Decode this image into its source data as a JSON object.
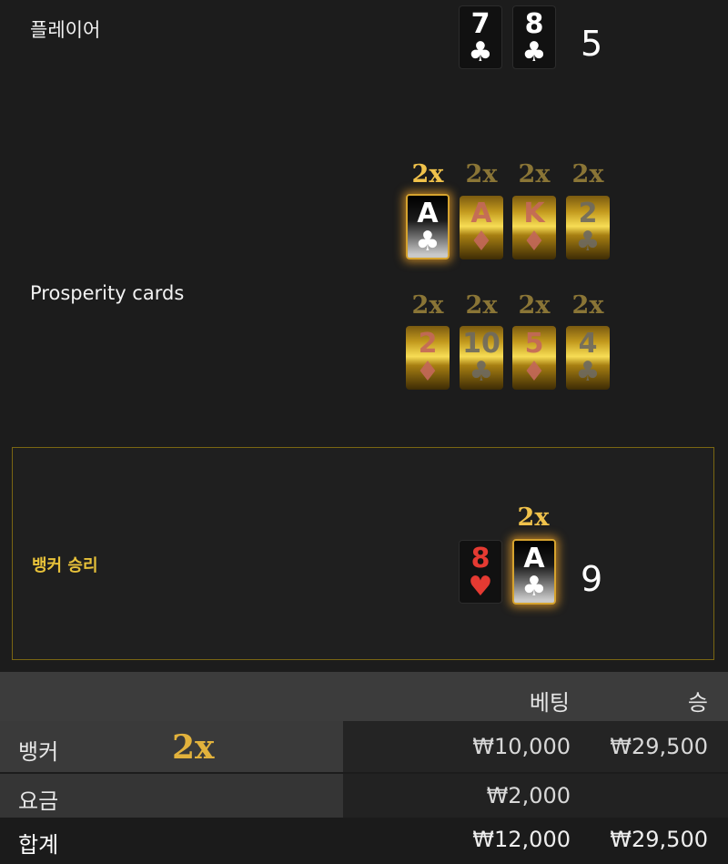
{
  "player": {
    "label": "플레이어",
    "cards": [
      {
        "rank": "7",
        "suit": "♣"
      },
      {
        "rank": "8",
        "suit": "♣"
      }
    ],
    "score": "5"
  },
  "prosperity": {
    "label": "Prosperity cards",
    "row1": [
      {
        "mult": "2x",
        "rank": "A",
        "suit": "♣",
        "active": true
      },
      {
        "mult": "2x",
        "rank": "A",
        "suit": "♦"
      },
      {
        "mult": "2x",
        "rank": "K",
        "suit": "♦"
      },
      {
        "mult": "2x",
        "rank": "2",
        "suit": "♣"
      }
    ],
    "row2": [
      {
        "mult": "2x",
        "rank": "2",
        "suit": "♦"
      },
      {
        "mult": "2x",
        "rank": "10",
        "suit": "♣"
      },
      {
        "mult": "2x",
        "rank": "5",
        "suit": "♦"
      },
      {
        "mult": "2x",
        "rank": "4",
        "suit": "♣"
      }
    ]
  },
  "banker": {
    "result_label": "뱅커 승리",
    "cards": [
      {
        "rank": "8",
        "suit": "♥"
      },
      {
        "rank": "A",
        "suit": "♣",
        "mult": "2x"
      }
    ],
    "score": "9"
  },
  "table": {
    "header": {
      "bet": "베팅",
      "win": "승"
    },
    "rows": [
      {
        "label": "뱅커",
        "mult": "2x",
        "bet": "₩10,000",
        "win": "₩29,500"
      },
      {
        "label": "요금",
        "bet": "₩2,000",
        "win": ""
      },
      {
        "label": "합계",
        "bet": "₩12,000",
        "win": "₩29,500"
      }
    ]
  },
  "colors": {
    "accent": "#f0c24b",
    "banner_border": "#7a6612",
    "red_suit": "#e53a32"
  }
}
